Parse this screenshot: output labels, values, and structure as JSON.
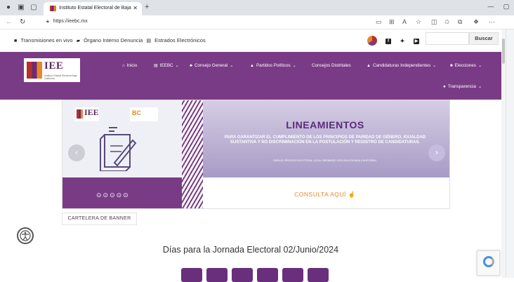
{
  "browser": {
    "tab_title": "Instituto Estatal Electoral de Baja",
    "url": "https://ieebc.mx"
  },
  "site": {
    "top_links": [
      "Transmisiones en vivo",
      "Órgano Interno Denuncia",
      "Estrados Electrónicos"
    ],
    "search_button": "Buscar",
    "logo_text": "IEE",
    "logo_subtitle": "Instituto Estatal Electoral Baja California"
  },
  "nav": {
    "items": [
      {
        "label": "Inicio"
      },
      {
        "label": "IEEBC"
      },
      {
        "label": "Consejo General"
      },
      {
        "label": "Partidos Políticos"
      },
      {
        "label": "Consejos Distritales"
      },
      {
        "label": "Candidaturas Independientes"
      },
      {
        "label": "Elecciones"
      }
    ],
    "transparencia": "Transparencia"
  },
  "hero": {
    "logo_iee": "IEE",
    "logo_bc": "BC",
    "title": "LINEAMIENTOS",
    "text": "PARA GARANTIZAR EL CUMPLIMIENTO DE LOS PRINCIPIOS DE PARIDAD DE GÉNERO, IGUALDAD SUSTANTIVA Y NO DISCRIMINACIÓN EN LA POSTULACIÓN Y REGISTRO DE CANDIDATURAS.",
    "small": "PARA EL PROCESO ELECTORAL LOCAL ORDINARIO 2023-2024 EN BAJA CALIFORNIA.",
    "cta": "CONSULTA AQUÍ"
  },
  "cartelera": "CARTELERA DE BANNER",
  "countdown": {
    "title": "Días para la Jornada Electoral 02/Junio/2024"
  },
  "colors": {
    "brand_purple": "#7a3b86",
    "accent_orange": "#e8862c"
  }
}
